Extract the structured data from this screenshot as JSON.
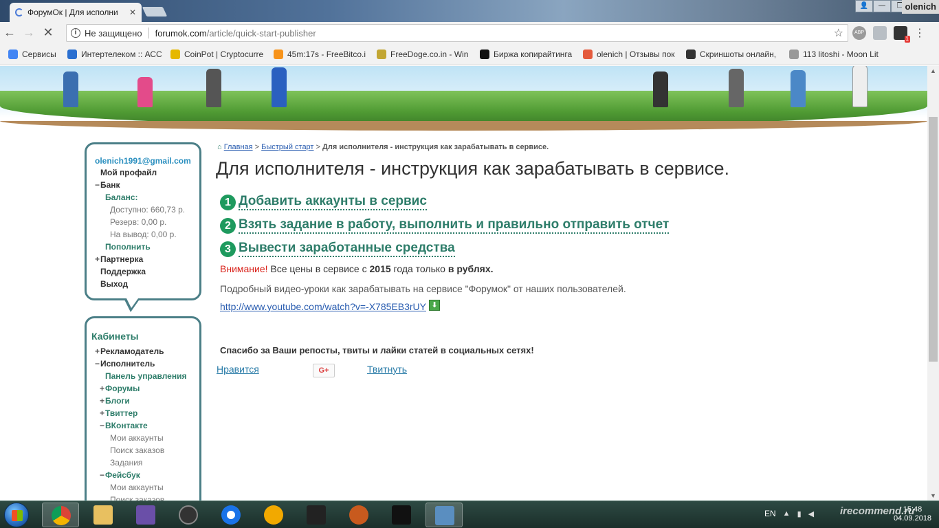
{
  "browser": {
    "tab_title": "ФорумОк | Для исполни",
    "tab_close": "✕",
    "win_user": "olenich",
    "security_label": "Не защищено",
    "url_host": "forumok.com",
    "url_path": "/article/quick-start-publisher",
    "ext_abp": "АВР",
    "ext_badge": "1",
    "bookmarks": [
      {
        "label": "Сервисы",
        "color": "#4285f4"
      },
      {
        "label": "Интертелеком :: АСС",
        "color": "#2a6fd0"
      },
      {
        "label": "CoinPot | Cryptocurre",
        "color": "#e6b800"
      },
      {
        "label": "45m:17s - FreeBitco.i",
        "color": "#f7931a"
      },
      {
        "label": "FreeDoge.co.in - Win",
        "color": "#c2a633"
      },
      {
        "label": "Биржа копирайтинга",
        "color": "#111111"
      },
      {
        "label": "olenich | Отзывы пок",
        "color": "#e45a3c"
      },
      {
        "label": "Скриншоты онлайн,",
        "color": "#333333"
      },
      {
        "label": "113 litoshi - Moon Lit",
        "color": "#999999"
      }
    ]
  },
  "breadcrumb": {
    "home": "Главная",
    "sep1": " > ",
    "quick": "Быстрый старт",
    "sep2": " > ",
    "current": "Для исполнителя - инструкция как зарабатывать в сервисе."
  },
  "main": {
    "title": "Для исполнителя - инструкция как зарабатывать в сервисе.",
    "steps": [
      {
        "num": "1",
        "label": "Добавить аккаунты в сервис"
      },
      {
        "num": "2",
        "label": "Взять задание в работу, выполнить и правильно отправить отчет"
      },
      {
        "num": "3",
        "label": "Вывести заработанные средства"
      }
    ],
    "notice_warn": "Внимание!",
    "notice_text1": " Все цены в сервисе с ",
    "notice_year": "2015",
    "notice_text2": " года только ",
    "notice_rub": "в рублях.",
    "video_desc": "Подробный видео-уроки как зарабатывать на сервисе \"Форумок\" от наших пользователей.",
    "video_link": "http://www.youtube.com/watch?v=-X785EB3rUY",
    "thanks": "Спасибо за Ваши репосты, твиты и лайки статей в социальных сетях!",
    "like": "Нравится",
    "gplus": "G+",
    "tweet": "Твитнуть"
  },
  "profile": {
    "email": "olenich1991@gmail.com",
    "my_profile": "Мой профайл",
    "bank": "Банк",
    "balance": "Баланс:",
    "available": "Доступно: 660,73 р.",
    "reserve": "Резерв: 0,00 р.",
    "withdraw": "На вывод: 0,00 р.",
    "topup": "Пополнить",
    "partner": "Партнерка",
    "support": "Поддержка",
    "exit": "Выход"
  },
  "cabinets": {
    "title": "Кабинеты",
    "advertiser": "Рекламодатель",
    "executor": "Исполнитель",
    "control_panel": "Панель управления",
    "forums": "Форумы",
    "blogs": "Блоги",
    "twitter": "Твиттер",
    "vk": "ВКонтакте",
    "vk_accounts": "Мои аккаунты",
    "vk_search": "Поиск заказов",
    "vk_tasks": "Задания",
    "fb": "Фейсбук",
    "fb_accounts": "Мои аккаунты",
    "fb_search": "Поиск заказов"
  },
  "taskbar": {
    "lang": "EN",
    "time": "15:48",
    "date": "04.09.2018",
    "watermark": "irecommend.ru"
  }
}
